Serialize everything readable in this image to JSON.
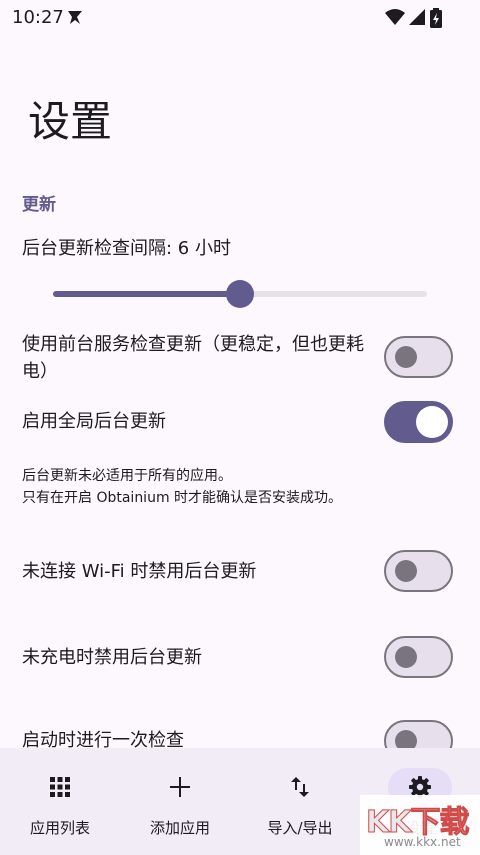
{
  "status_bar": {
    "time": "10:27"
  },
  "page": {
    "title": "设置"
  },
  "section": {
    "title": "更新"
  },
  "interval": {
    "label": "后台更新检查间隔: 6 小时",
    "value_fraction": 0.5
  },
  "settings": [
    {
      "label": "使用前台服务检查更新（更稳定，但也更耗电）",
      "enabled": false
    },
    {
      "label": "启用全局后台更新",
      "enabled": true
    },
    {
      "label": "未连接 Wi-Fi 时禁用后台更新",
      "enabled": false
    },
    {
      "label": "未充电时禁用后台更新",
      "enabled": false
    },
    {
      "label": "启动时进行一次检查",
      "enabled": false
    }
  ],
  "background_note": {
    "line1": "后台更新未必适用于所有的应用。",
    "line2": "只有在开启 Obtainium 时才能确认是否安装成功。"
  },
  "nav": [
    {
      "label": "应用列表",
      "icon": "apps-grid-icon",
      "active": false
    },
    {
      "label": "添加应用",
      "icon": "plus-icon",
      "active": false
    },
    {
      "label": "导入/导出",
      "icon": "import-export-icon",
      "active": false
    },
    {
      "label": "设置",
      "icon": "gear-icon",
      "active": true
    }
  ],
  "watermark": {
    "logo": "KK下载",
    "url": "www.kkx.net"
  },
  "colors": {
    "accent": "#625b8e",
    "background": "#fdf8fd",
    "nav_background": "#f2ecf6"
  }
}
